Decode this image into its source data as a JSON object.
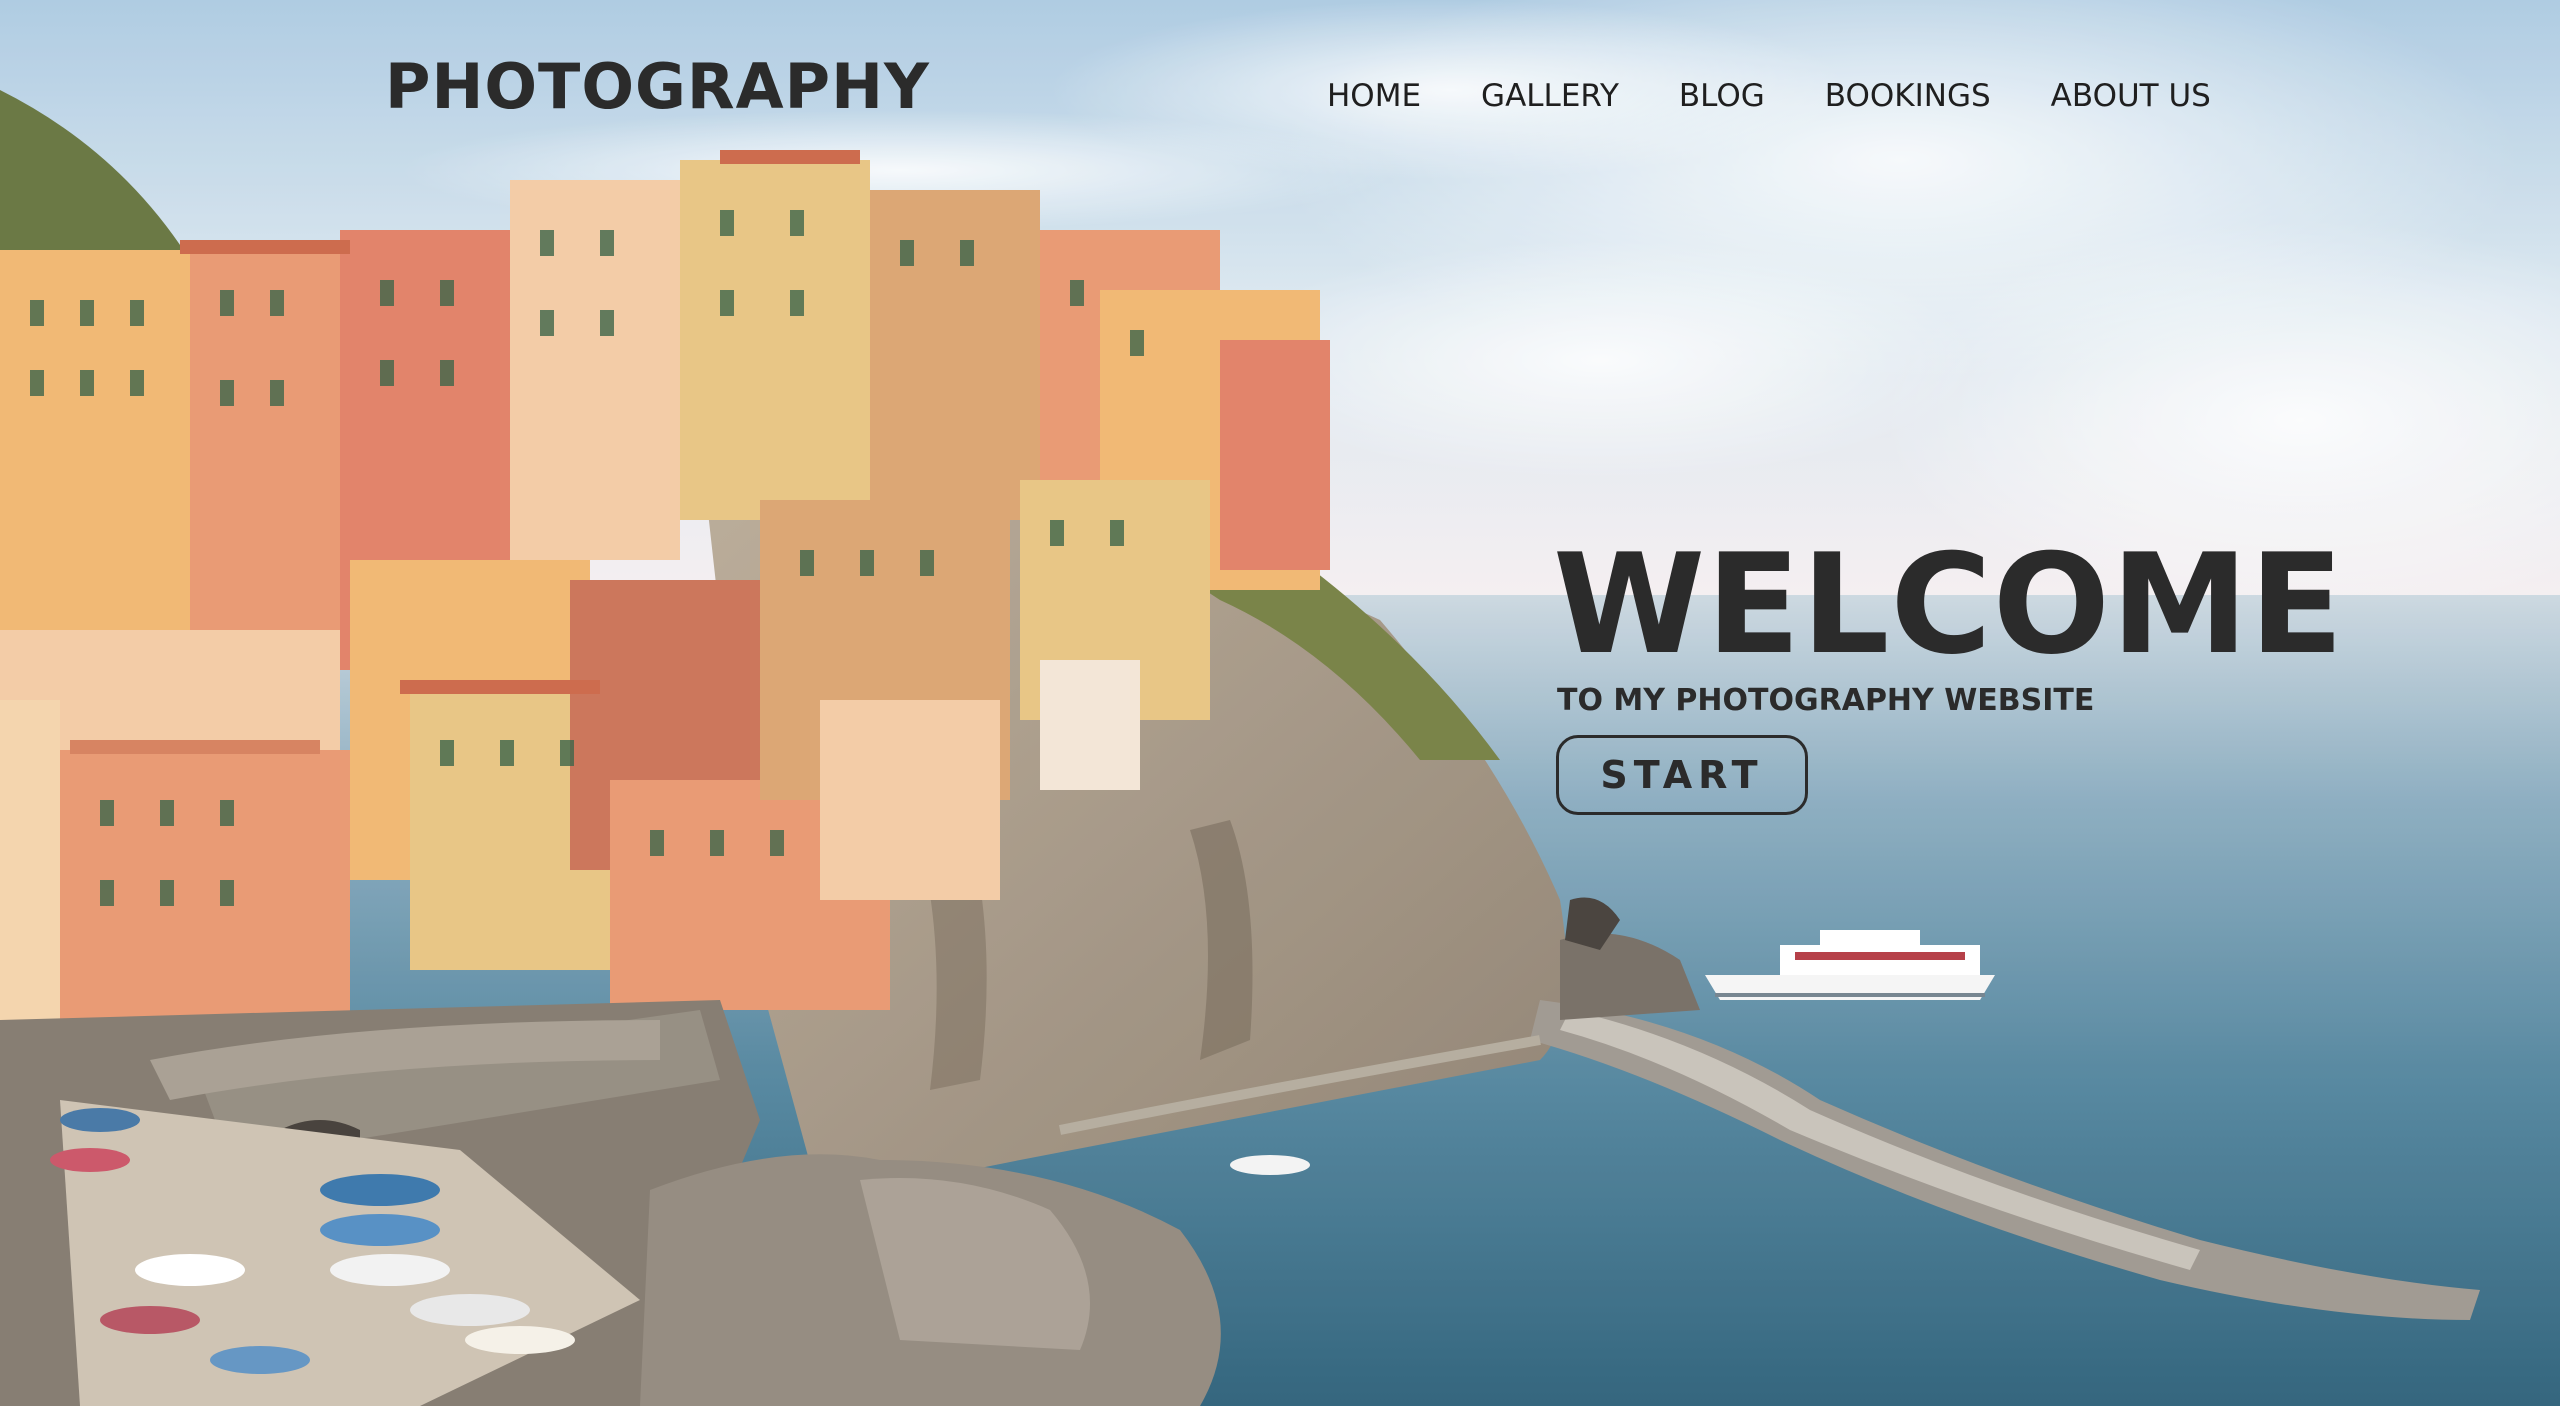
{
  "header": {
    "brand": "PHOTOGRAPHY",
    "nav": [
      "HOME",
      "GALLERY",
      "BLOG",
      "BOOKINGS",
      "ABOUT US"
    ]
  },
  "hero": {
    "heading": "WELCOME",
    "subheading": "TO MY PHOTOGRAPHY WEBSITE",
    "cta_label": "START"
  },
  "colors": {
    "text": "#2b2b2b",
    "sky": "#cfe0ec",
    "sea": "#2e6a86",
    "cliff": "#a89a86",
    "vegetation": "#6f7a3a",
    "buildings": [
      "#e8936a",
      "#f0b36a",
      "#e7c27c",
      "#e07a5f",
      "#f2c8a0",
      "#d9a06a",
      "#c86c4f"
    ]
  }
}
